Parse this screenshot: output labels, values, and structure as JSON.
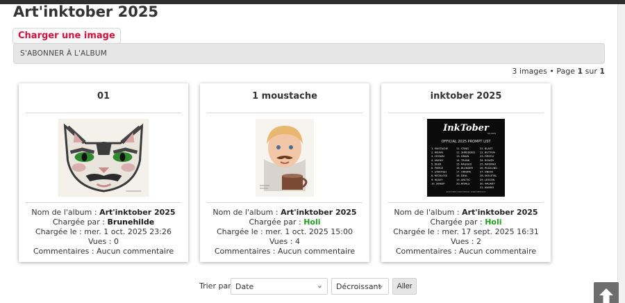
{
  "page": {
    "title": "Art'inktober 2025"
  },
  "toolbar": {
    "upload_label": "Charger une image"
  },
  "subscribe": {
    "label": "S'ABONNER À L'ALBUM"
  },
  "pagination": {
    "prefix": "3 images • Page ",
    "current": "1",
    "middle": " sur ",
    "total": "1"
  },
  "meta_labels": {
    "album": "Nom de l'album : ",
    "uploader": "Chargée par : ",
    "uploaded_on": "Chargée le : ",
    "views": "Vues : ",
    "comments": "Commentaires : "
  },
  "images": [
    {
      "title": "01",
      "album": "Art'inktober 2025",
      "uploader": "Brunehilde",
      "date": "mer. 1 oct. 2025 23:26",
      "views": "0",
      "comments": "Aucun commentaire"
    },
    {
      "title": "1 moustache",
      "album": "Art'inktober 2025",
      "uploader": "Holi",
      "date": "mer. 1 oct. 2025 15:00",
      "views": "4",
      "comments": "Aucun commentaire"
    },
    {
      "title": "inktober 2025",
      "album": "Art'inktober 2025",
      "uploader": "Holi",
      "date": "mer. 17 sept. 2025 16:31",
      "views": "2",
      "comments": "Aucun commentaire"
    }
  ],
  "prompt_list_image": {
    "logo": "InkTober",
    "logo_sub": "52 DAYS",
    "heading": "OFFICIAL 2025 PROMPT LIST",
    "col1": [
      "1. MUSTACHE",
      "2. WEAVE",
      "3. CROWN",
      "4. MURKY",
      "5. DEER",
      "6. PIERCE",
      "7. STARFISH",
      "8. RECKLESS",
      "9. HEAVY",
      "10. SWEEP"
    ],
    "col2": [
      "11. STING",
      "12. SHREDDED",
      "13. DRAIN",
      "14. TRUNK",
      "15. RAGGED",
      "16. BLUNDER",
      "17. ORNATE",
      "18. DEAL",
      "19. ARCTIC",
      "20. RIVALS"
    ],
    "col3": [
      "21. BLAST",
      "22. BUTTON",
      "23. FIREFLY",
      "24. ROWDY",
      "25. INFERNO",
      "26. PUZZLING",
      "27. ONION",
      "28. SKELETAL",
      "29. LESSON",
      "30. VACANT",
      "31. AWARD"
    ],
    "footer": "#INKTOBER   #INKTOBER52   #INKTOBER2025"
  },
  "sort": {
    "label": "Trier par",
    "field_value": "Date",
    "order_value": "Décroissant",
    "go_label": "Aller"
  },
  "colors": {
    "accent": "#d1143f",
    "user_green": "#1f9e1f",
    "topbar": "#2e2e2e"
  }
}
